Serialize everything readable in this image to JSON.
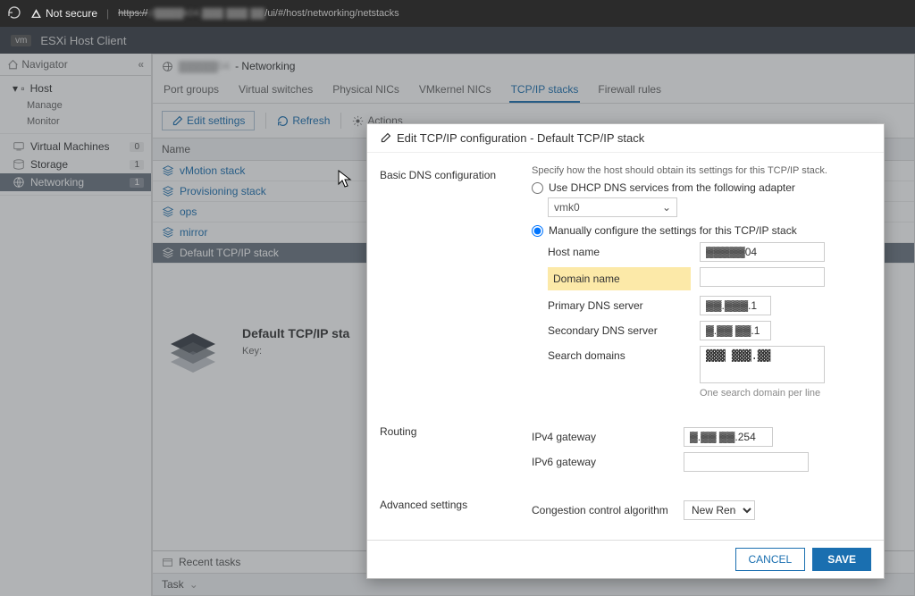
{
  "browser": {
    "not_secure": "Not secure",
    "url_https": "https://",
    "url_host_blur": "cl▓▓▓▓k04.▓▓▓ ▓▓▓ ▓▓",
    "url_path": "/ui/#/host/networking/netstacks"
  },
  "header": {
    "vm": "vm",
    "title": "ESXi Host Client"
  },
  "sidebar": {
    "title": "Navigator",
    "host": "Host",
    "manage": "Manage",
    "monitor": "Monitor",
    "vms": "Virtual Machines",
    "vms_count": "0",
    "storage": "Storage",
    "storage_count": "1",
    "networking": "Networking",
    "networking_count": "1"
  },
  "content": {
    "breadcrumb_host_blur": "▓▓▓▓▓04",
    "breadcrumb_section": "- Networking",
    "tabs": [
      "Port groups",
      "Virtual switches",
      "Physical NICs",
      "VMkernel NICs",
      "TCP/IP stacks",
      "Firewall rules"
    ],
    "toolbar": {
      "edit": "Edit settings",
      "refresh": "Refresh",
      "actions": "Actions"
    },
    "table": {
      "header_name": "Name",
      "rows": [
        "vMotion stack",
        "Provisioning stack",
        "ops",
        "mirror",
        "Default TCP/IP stack"
      ]
    },
    "detail": {
      "title": "Default TCP/IP sta",
      "key": "Key:"
    },
    "recent_tasks": "Recent tasks",
    "task": "Task"
  },
  "modal": {
    "title": "Edit TCP/IP configuration - Default TCP/IP stack",
    "sections": {
      "dns_label": "Basic DNS configuration",
      "dns_hint": "Specify how the host should obtain its settings for this TCP/IP stack.",
      "radio_dhcp": "Use DHCP DNS services from the following adapter",
      "adapter": "vmk0",
      "radio_manual": "Manually configure the settings for this TCP/IP stack",
      "hostname_label": "Host name",
      "hostname_value": "▓▓▓▓▓04",
      "domain_label": "Domain name",
      "domain_value": "",
      "primary_dns_label": "Primary DNS server",
      "primary_dns_value": "▓▓.▓▓▓.1",
      "secondary_dns_label": "Secondary DNS server",
      "secondary_dns_value": "▓.▓▓ ▓▓.1",
      "search_label": "Search domains",
      "search_value": "▓▓▓ ▓▓▓.▓▓",
      "search_hint": "One search domain per line",
      "routing_label": "Routing",
      "ipv4_label": "IPv4 gateway",
      "ipv4_value": "▓.▓▓ ▓▓.254",
      "ipv6_label": "IPv6 gateway",
      "ipv6_value": "",
      "advanced_label": "Advanced settings",
      "congestion_label": "Congestion control algorithm",
      "congestion_value": "New Reno"
    },
    "cancel": "CANCEL",
    "save": "SAVE"
  }
}
